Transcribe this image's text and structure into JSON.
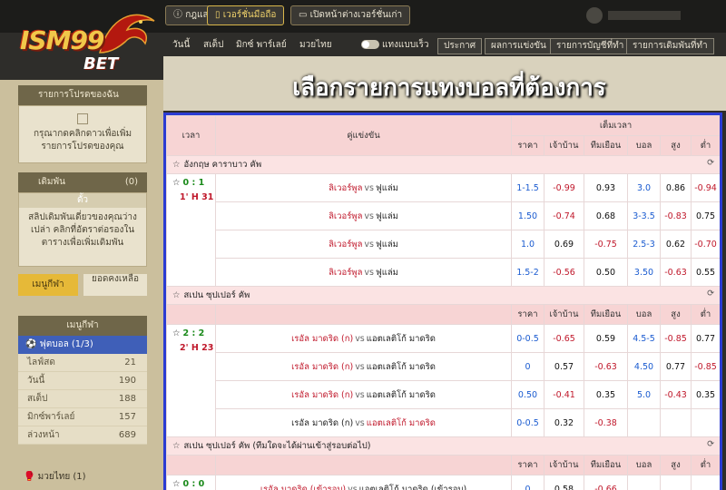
{
  "topbar": {
    "buttons": [
      "กฎและกติกา",
      "เวอร์ชั่นมือถือ",
      "เปิดหน้าต่างเวอร์ชั่นเก่า"
    ]
  },
  "logo": {
    "brand": "ISM99",
    "sub": "BET"
  },
  "menubar": {
    "items": [
      "วันนี้",
      "สเต็ป",
      "มิกซ์ พาร์เลย์",
      "มวยไทย"
    ],
    "toggle_label": "แทงแบบเร็ว",
    "boxes": [
      "ประกาศ",
      "ผลการแข่งขัน",
      "รายการบัญชีที่ทำ",
      "รายการเดิมพันที่ทำ"
    ]
  },
  "headline": "เลือกรายการแทงบอลที่ต้องการ",
  "sidebar": {
    "card1_title": "รายการโปรดของฉัน",
    "card1_text": "กรุณากดคลิกดาวเพื่อเพิ่มรายการโปรดของคุณ",
    "bet_head": "เดิมพัน",
    "bet_count": "(0)",
    "bet_text": "สลิปเดิมพันเดี่ยวของคุณว่างเปล่า คลิกที่อัตราต่อรองในตารางเพื่อเพิ่มเดิมพัน",
    "btn_left": "เมนูกีฬา",
    "btn_right": "ยอดคงเหลือ",
    "sports_head": "เมนูกีฬา",
    "football": "ฟุตบอล (1/3)",
    "rows": [
      {
        "label": "ไลฟ์สด",
        "count": "21"
      },
      {
        "label": "วันนี้",
        "count": "190"
      },
      {
        "label": "สเต็ป",
        "count": "188"
      },
      {
        "label": "มิกซ์พาร์เลย์",
        "count": "157"
      },
      {
        "label": "ล่วงหน้า",
        "count": "689"
      }
    ],
    "muay": "มวยไทย (1)"
  },
  "table": {
    "col_time": "เวลา",
    "col_match": "คู่แข่งขัน",
    "col_fulltime": "เต็มเวลา",
    "sub_cols": [
      "ราคา",
      "เจ้าบ้าน",
      "ทีมเยือน",
      "บอล",
      "สูง",
      "ต่ำ"
    ],
    "vs": "vs",
    "leagues": [
      {
        "name": "อังกฤษ คาราบาว คัพ",
        "score": "0 : 1",
        "time": "1' H 31",
        "show_subhdr": false,
        "rows": [
          {
            "home": "ลิเวอร์พูล",
            "away": "ฟูแล่ม",
            "fav": "home",
            "hdp": "1-1.5",
            "h": "-0.99",
            "a": "0.93",
            "ou": "3.0",
            "over": "0.86",
            "under": "-0.94"
          },
          {
            "home": "ลิเวอร์พูล",
            "away": "ฟูแล่ม",
            "fav": "home",
            "hdp": "1.50",
            "h": "-0.74",
            "a": "0.68",
            "ou": "3-3.5",
            "over": "-0.83",
            "under": "0.75"
          },
          {
            "home": "ลิเวอร์พูล",
            "away": "ฟูแล่ม",
            "fav": "home",
            "hdp": "1.0",
            "h": "0.69",
            "a": "-0.75",
            "ou": "2.5-3",
            "over": "0.62",
            "under": "-0.70"
          },
          {
            "home": "ลิเวอร์พูล",
            "away": "ฟูแล่ม",
            "fav": "home",
            "hdp": "1.5-2",
            "h": "-0.56",
            "a": "0.50",
            "ou": "3.50",
            "over": "-0.63",
            "under": "0.55"
          }
        ]
      },
      {
        "name": "สเปน ซุปเปอร์ คัพ",
        "score": "2 : 2",
        "time": "2' H 23",
        "show_subhdr": true,
        "rows": [
          {
            "home": "เรอัล มาดริด (ก)",
            "away": "แอตเลติโก้ มาดริด",
            "fav": "home",
            "hdp": "0-0.5",
            "h": "-0.65",
            "a": "0.59",
            "ou": "4.5-5",
            "over": "-0.85",
            "under": "0.77"
          },
          {
            "home": "เรอัล มาดริด (ก)",
            "away": "แอตเลติโก้ มาดริด",
            "fav": "home",
            "hdp": "0",
            "h": "0.57",
            "a": "-0.63",
            "ou": "4.50",
            "over": "0.77",
            "under": "-0.85"
          },
          {
            "home": "เรอัล มาดริด (ก)",
            "away": "แอตเลติโก้ มาดริด",
            "fav": "home",
            "hdp": "0.50",
            "h": "-0.41",
            "a": "0.35",
            "ou": "5.0",
            "over": "-0.43",
            "under": "0.35"
          },
          {
            "home": "เรอัล มาดริด (ก)",
            "away": "แอตเลติโก้ มาดริด",
            "fav": "away",
            "hdp": "0-0.5",
            "h": "0.32",
            "a": "-0.38",
            "ou": "",
            "over": "",
            "under": ""
          }
        ]
      },
      {
        "name": "สเปน ซุปเปอร์ คัพ (ทีมใดจะได้ผ่านเข้าสู่รอบต่อไป)",
        "score": "0 : 0",
        "time": "",
        "show_subhdr": true,
        "rows": [
          {
            "home": "เรอัล มาดริด (เข้ารอบ)",
            "away": "แอตเลติโก้ มาดริด (เข้ารอบ)",
            "fav": "home",
            "hdp": "0",
            "h": "0.58",
            "a": "-0.66",
            "ou": "",
            "over": "",
            "under": ""
          }
        ]
      }
    ]
  }
}
